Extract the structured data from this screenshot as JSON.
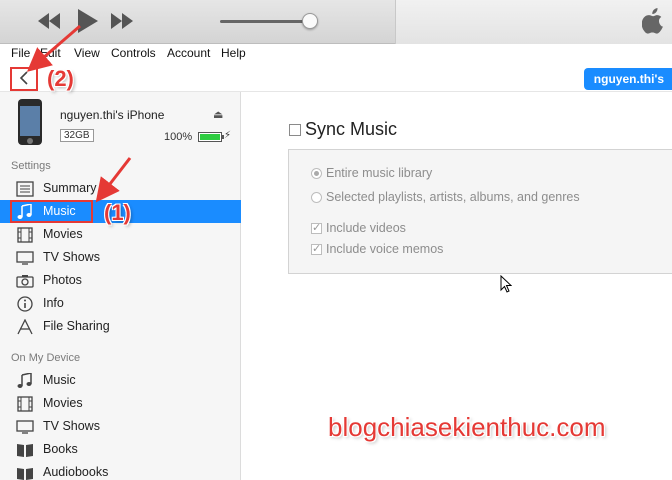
{
  "menu": [
    "File",
    "Edit",
    "View",
    "Controls",
    "Account",
    "Help"
  ],
  "nav": {
    "device_pill": "nguyen.thi's"
  },
  "device": {
    "name": "nguyen.thi's iPhone",
    "capacity": "32GB",
    "battery_percent": "100%",
    "battery_level": 1.0
  },
  "sidebar": {
    "settings_title": "Settings",
    "settings_items": [
      "Summary",
      "Music",
      "Movies",
      "TV Shows",
      "Photos",
      "Info",
      "File Sharing"
    ],
    "active_index": 1,
    "on_device_title": "On My Device",
    "on_device_items": [
      "Music",
      "Movies",
      "TV Shows",
      "Books",
      "Audiobooks"
    ]
  },
  "main": {
    "sync_title": "Sync Music",
    "sync_checked": false,
    "options": {
      "entire_library": "Entire music library",
      "selected": "Selected playlists, artists, albums, and genres",
      "include_videos": "Include videos",
      "include_voice_memos": "Include voice memos"
    }
  },
  "annotations": {
    "label_1": "(1)",
    "label_2": "(2)"
  },
  "watermark": "blogchiasekienthuc.com",
  "colors": {
    "accent": "#1a8cff",
    "annotation": "#e53935"
  }
}
